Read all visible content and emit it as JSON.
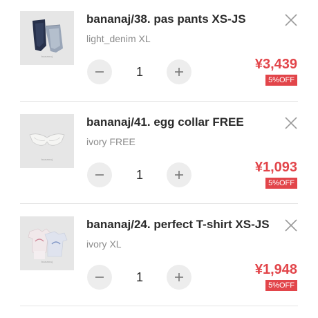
{
  "colors": {
    "accent": "#e2454a",
    "button_bg": "#ededed",
    "divider": "#e4e4e4",
    "thumb_bg": "#e6e6e6"
  },
  "items": [
    {
      "name": "bananaj/38. pas pants XS-JS",
      "variant": "light_denim XL",
      "quantity": "1",
      "price": "¥3,439",
      "discount": "5%OFF",
      "thumb_caption": "bananaj",
      "thumb_icon": "denim-pants-image"
    },
    {
      "name": "bananaj/41. egg collar FREE",
      "variant": "ivory FREE",
      "quantity": "1",
      "price": "¥1,093",
      "discount": "5%OFF",
      "thumb_caption": "bananaj",
      "thumb_icon": "collar-image"
    },
    {
      "name": "bananaj/24. perfect T-shirt XS-JS",
      "variant": "ivory XL",
      "quantity": "1",
      "price": "¥1,948",
      "discount": "5%OFF",
      "thumb_caption": "bananaj",
      "thumb_icon": "tshirt-image"
    }
  ],
  "icons": {
    "remove": "close-icon",
    "decrease": "minus-icon",
    "increase": "plus-icon"
  }
}
